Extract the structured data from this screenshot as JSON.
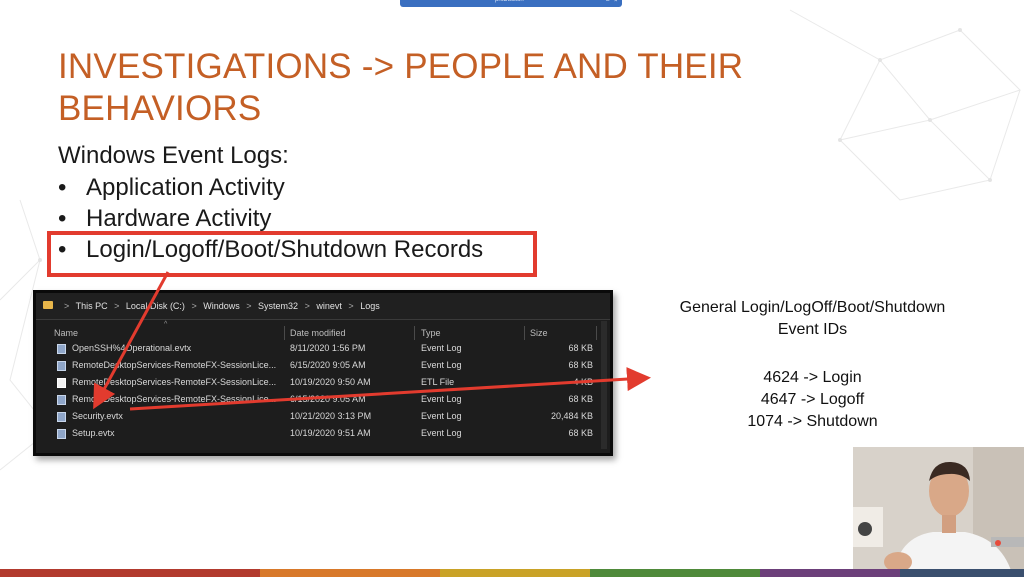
{
  "window": {
    "title": "prsDuction"
  },
  "slide": {
    "title_line1": "INVESTIGATIONS -> PEOPLE AND THEIR",
    "title_line2": "BEHAVIORS",
    "subheading": "Windows Event Logs:",
    "bullets": [
      "Application Activity",
      "Hardware Activity",
      "Login/Logoff/Boot/Shutdown Records"
    ],
    "bullet_char": "•"
  },
  "explorer": {
    "breadcrumb": [
      "This PC",
      "Local Disk (C:)",
      "Windows",
      "System32",
      "winevt",
      "Logs"
    ],
    "breadcrumb_sep": ">",
    "columns": {
      "name": "Name",
      "date": "Date modified",
      "type": "Type",
      "size": "Size"
    },
    "rows": [
      {
        "name": "OpenSSH%4Operational.evtx",
        "date": "8/11/2020 1:56 PM",
        "type": "Event Log",
        "size": "68 KB",
        "icon": "evtx-file-icon"
      },
      {
        "name": "RemoteDesktopServices-RemoteFX-SessionLice...",
        "date": "6/15/2020 9:05 AM",
        "type": "Event Log",
        "size": "68 KB",
        "icon": "evtx-file-icon"
      },
      {
        "name": "RemoteDesktopServices-RemoteFX-SessionLice...",
        "date": "10/19/2020 9:50 AM",
        "type": "ETL File",
        "size": "4 KB",
        "icon": "etl-file-icon"
      },
      {
        "name": "RemoteDesktopServices-RemoteFX-SessionLice...",
        "date": "6/15/2020 9:05 AM",
        "type": "Event Log",
        "size": "68 KB",
        "icon": "evtx-file-icon"
      },
      {
        "name": "Security.evtx",
        "date": "10/21/2020 3:13 PM",
        "type": "Event Log",
        "size": "20,484 KB",
        "icon": "evtx-file-icon"
      },
      {
        "name": "Setup.evtx",
        "date": "10/19/2020 9:51 AM",
        "type": "Event Log",
        "size": "68 KB",
        "icon": "evtx-file-icon"
      }
    ]
  },
  "events": {
    "heading_line1": "General Login/LogOff/Boot/Shutdown",
    "heading_line2": "Event IDs",
    "ids": [
      "4624 -> Login",
      "4647 -> Logoff",
      "1074 -> Shutdown"
    ]
  },
  "colors": {
    "title": "#c45f25",
    "annotation_red": "#e23b2e",
    "bottom_bar": [
      "#c0392b",
      "#e67e22",
      "#f1c40f",
      "#27ae60",
      "#8e44ad",
      "#2c3e50"
    ]
  }
}
